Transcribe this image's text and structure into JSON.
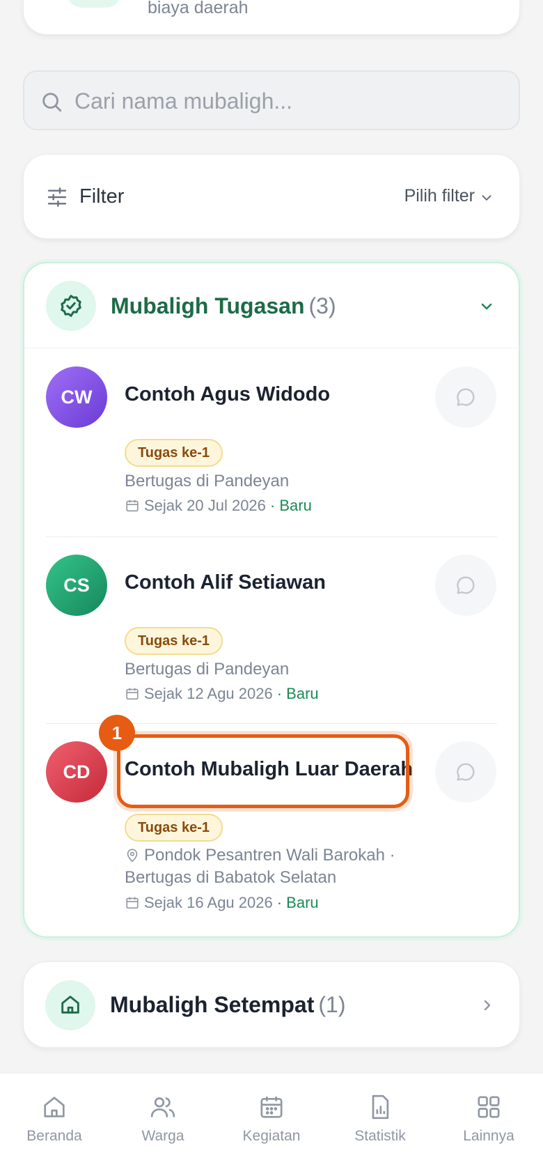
{
  "top_card": {
    "text": "biaya daerah"
  },
  "search": {
    "placeholder": "Cari nama mubaligh..."
  },
  "filter": {
    "label": "Filter",
    "pick_label": "Pilih filter"
  },
  "tugasan": {
    "title": "Mubaligh Tugasan",
    "count": "(3)",
    "entries": [
      {
        "initials": "CW",
        "name": "Contoh Agus Widodo",
        "badge": "Tugas ke-1",
        "location": "Bertugas di Pandeyan",
        "since": "Sejak 20 Jul 2026",
        "status": "· Baru",
        "avatar_color": "#7c4de0"
      },
      {
        "initials": "CS",
        "name": "Contoh Alif Setiawan",
        "badge": "Tugas ke-1",
        "location": "Bertugas di Pandeyan",
        "since": "Sejak 12 Agu 2026",
        "status": "· Baru",
        "avatar_color": "#1f9a6c"
      },
      {
        "initials": "CD",
        "name": "Contoh Mubaligh Luar Daerah",
        "badge": "Tugas ke-1",
        "origin": "Pondok Pesantren Wali Barokah ·",
        "location": "Bertugas di Babatok Selatan",
        "since": "Sejak 16 Agu 2026",
        "status": "· Baru",
        "avatar_color": "#d93a4a"
      }
    ]
  },
  "annotation": {
    "number": "1",
    "color": "#e65c12"
  },
  "setempat": {
    "title": "Mubaligh Setempat",
    "count": "(1)"
  },
  "nav": [
    {
      "label": "Beranda",
      "icon": "home-icon"
    },
    {
      "label": "Warga",
      "icon": "users-icon"
    },
    {
      "label": "Kegiatan",
      "icon": "calendar-icon"
    },
    {
      "label": "Statistik",
      "icon": "chart-icon"
    },
    {
      "label": "Lainnya",
      "icon": "grid-icon"
    }
  ]
}
